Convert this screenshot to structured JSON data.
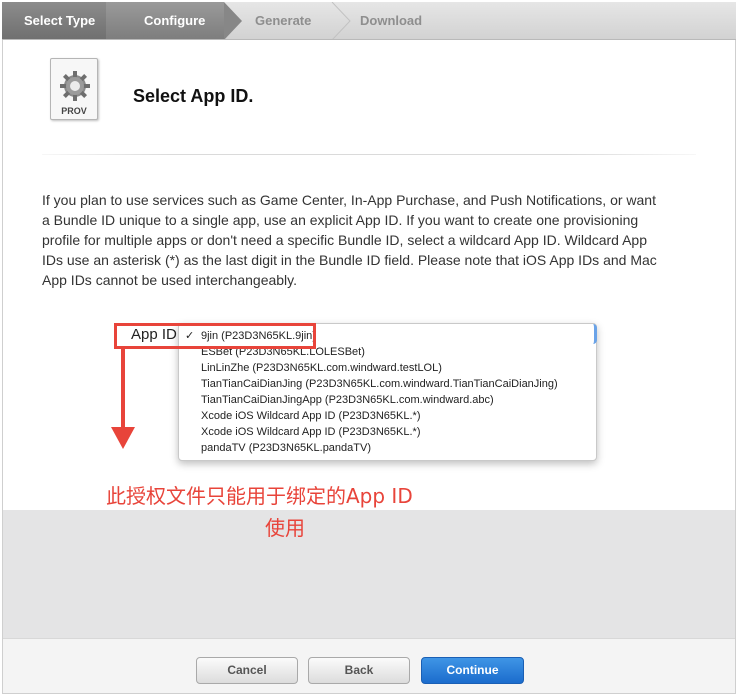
{
  "steps": [
    {
      "label": "Select Type"
    },
    {
      "label": "Configure"
    },
    {
      "label": "Generate"
    },
    {
      "label": "Download"
    }
  ],
  "icon": {
    "name": "provisioning-profile-icon",
    "label": "PROV"
  },
  "page": {
    "title": "Select App ID.",
    "description": "If you plan to use services such as Game Center, In-App Purchase, and Push Notifications, or want a Bundle ID unique to a single app, use an explicit App ID. If you want to create one provisioning profile for multiple apps or don't need a specific Bundle ID, select a wildcard App ID. Wildcard App IDs use an asterisk (*) as the last digit in the Bundle ID field. Please note that iOS App IDs and Mac App IDs cannot be used interchangeably."
  },
  "app_id": {
    "label": "App ID",
    "selected_index": 0,
    "options": [
      "9jin (P23D3N65KL.9jin)",
      "ESBet (P23D3N65KL.LOLESBet)",
      "LinLinZhe (P23D3N65KL.com.windward.testLOL)",
      "TianTianCaiDianJing (P23D3N65KL.com.windward.TianTianCaiDianJing)",
      "TianTianCaiDianJingApp (P23D3N65KL.com.windward.abc)",
      "Xcode iOS Wildcard App ID (P23D3N65KL.*)",
      "Xcode iOS Wildcard App ID (P23D3N65KL.*)",
      "pandaTV (P23D3N65KL.pandaTV)"
    ]
  },
  "annotation": {
    "line1": "此授权文件只能用于绑定的App ID",
    "line2": "使用",
    "color": "#e8443a"
  },
  "buttons": {
    "cancel": "Cancel",
    "back": "Back",
    "continue": "Continue"
  },
  "colors": {
    "primary_button": "#1b6ccd",
    "annotation": "#e8443a"
  }
}
